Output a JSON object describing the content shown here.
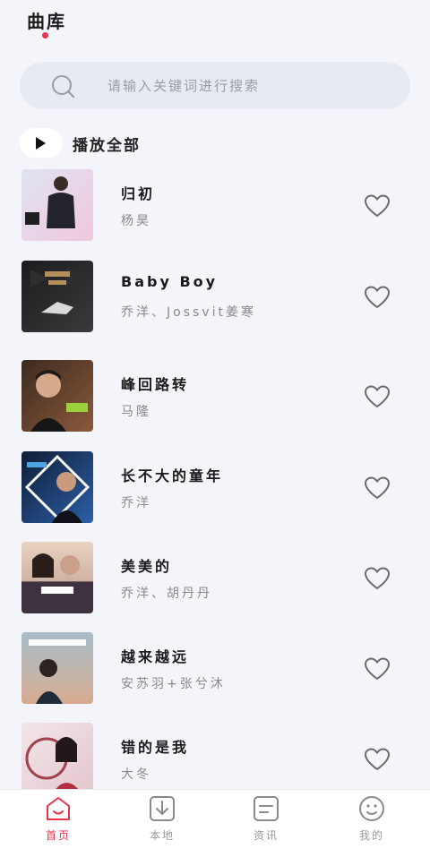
{
  "header": {
    "title": "曲库"
  },
  "search": {
    "placeholder": "请输入关键词进行搜索",
    "icon": "search-icon"
  },
  "play_all": {
    "label": "播放全部",
    "icon": "play-icon"
  },
  "songs": [
    {
      "title": "归初",
      "artist": "杨昊",
      "cover_colors": [
        "#dfe4f2",
        "#f1c7dd"
      ]
    },
    {
      "title": "Baby Boy",
      "artist": "乔洋、Jossvit姜寒",
      "cover_colors": [
        "#1c1c1e",
        "#3a3a3c"
      ]
    },
    {
      "title": "峰回路转",
      "artist": "马隆",
      "cover_colors": [
        "#3b2a1e",
        "#8b5a3c"
      ]
    },
    {
      "title": "长不大的童年",
      "artist": "乔洋",
      "cover_colors": [
        "#0f1e35",
        "#2c5fa8"
      ]
    },
    {
      "title": "美美的",
      "artist": "乔洋、胡丹丹",
      "cover_colors": [
        "#e8d2c0",
        "#3f3340"
      ]
    },
    {
      "title": "越来越远",
      "artist": "安苏羽+张兮沐",
      "cover_colors": [
        "#a7bcc9",
        "#d8a98e"
      ]
    },
    {
      "title": "错的是我",
      "artist": "大冬",
      "cover_colors": [
        "#f2e6ea",
        "#a3424f"
      ]
    }
  ],
  "tabs": [
    {
      "label": "首页",
      "icon": "home-icon",
      "active": true
    },
    {
      "label": "本地",
      "icon": "download-icon",
      "active": false
    },
    {
      "label": "资讯",
      "icon": "news-icon",
      "active": false
    },
    {
      "label": "我的",
      "icon": "profile-icon",
      "active": false
    }
  ],
  "colors": {
    "accent": "#e8344c",
    "background": "#f4f5fa",
    "search_bg": "#e7eaf3"
  }
}
